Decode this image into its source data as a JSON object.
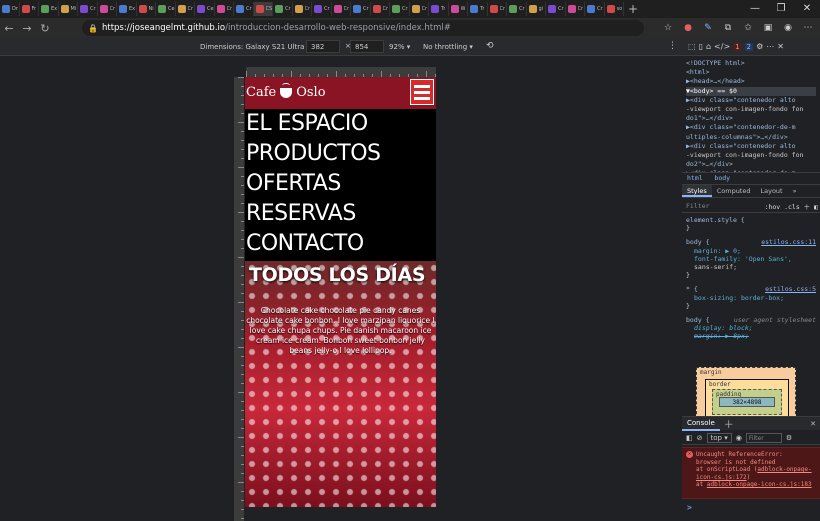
{
  "browser": {
    "url_host": "https://joseangelmt.github.io",
    "url_path": "/introduccion-desarrollo-web-responsive/index.html#",
    "tabs": [
      "Dr",
      "Fr",
      "Ex",
      "Mi",
      "Cr",
      "Cr",
      "Ex",
      "Ni",
      "Ce",
      "Cr",
      "Ce",
      "Cr",
      "Cr",
      "CS",
      "Cr",
      "Cr",
      "Cr",
      "Cr",
      "Cr",
      "Cr",
      "Cr",
      "Cr",
      "Tr",
      "W",
      "Tr",
      "Cr",
      "Cr",
      "gi",
      "Cr",
      "Cr",
      "Cr",
      "so"
    ]
  },
  "device_toolbar": {
    "dimensions": "Dimensions: Galaxy S21 Ultra ▾",
    "width": "382",
    "times": "×",
    "height": "854",
    "zoom": "92% ▾",
    "throttling": "No throttling ▾"
  },
  "devtools_header": {
    "errors": "1",
    "infos": "2"
  },
  "page": {
    "logo_left": "Cafe",
    "logo_right": "Oslo",
    "menu": [
      "EL ESPACIO",
      "PRODUCTOS",
      "OFERTAS",
      "RESERVAS",
      "CONTACTO"
    ],
    "hero_title": "TODOS LOS DÍAS",
    "hero_text": "Chocolate cake chocolate pie candy canes chocolate cake bonbon. I love marzipan liquorice I love cake chupa chups. Pie danish macaroon ice cream ice cream. Bonbon sweet bonbon jelly beans jelly-o I love lollipop."
  },
  "elements_panel": {
    "lines": [
      "<!DOCTYPE html>",
      "<html>",
      "▶<head>…</head>",
      "▼<body> == $0",
      "  ▶<div class=\"contenedor alto",
      "  -viewport con-imagen-fondo fon",
      "  do1\">…</div>",
      "  ▶<div class=\"contenedor-de-m",
      "  ultiples-columnas\">…</div>",
      "  ▶<div class=\"contenedor alto",
      "  -viewport con-imagen-fondo fon",
      "  do2\">…</div>",
      "  ▶<div class=\"contenedor-de-m"
    ]
  },
  "breadcrumbs": [
    "html",
    "body"
  ],
  "styles_tabs": [
    "Styles",
    "Computed",
    "Layout",
    "»"
  ],
  "filter": {
    "placeholder": "Filter",
    "hov": ":hov",
    "cls": ".cls"
  },
  "styles": {
    "element_style": "element.style {",
    "close": "}",
    "rule1_sel": "body {",
    "rule1_link": "estilos.css:11",
    "rule1_p1": "margin: ▶ 0;",
    "rule1_p2": "font-family: 'Open Sans',",
    "rule1_p3": "    sans-serif;",
    "rule2_sel": "* {",
    "rule2_link": "estilos.css:5",
    "rule2_p1": "box-sizing: border-box;",
    "rule3_sel": "body {",
    "rule3_ua": "user agent stylesheet",
    "rule3_p1": "display: block;",
    "rule3_p2": "margin: ▶ 8px;"
  },
  "box_model": {
    "margin": "margin",
    "border": "border",
    "padding": "padding",
    "content": "382×4898"
  },
  "console": {
    "tab": "Console",
    "context": "top ▾",
    "filter": "Filter",
    "error_line1": "Uncaught ReferenceError:",
    "error_line2": "browser is not defined",
    "error_line3": "    at onScriptLoad (",
    "error_link1": "adblock-onpage-icon-cs.js:172",
    "error_line4": "    at ",
    "error_link2": "adblock-onpage-icon-cs.js:183",
    "prompt": ">"
  },
  "colors": {
    "header_red": "#8b1424",
    "hamburger_red": "#d42b2b",
    "devtools_bg": "#202124",
    "error_bg": "#4e1717"
  }
}
